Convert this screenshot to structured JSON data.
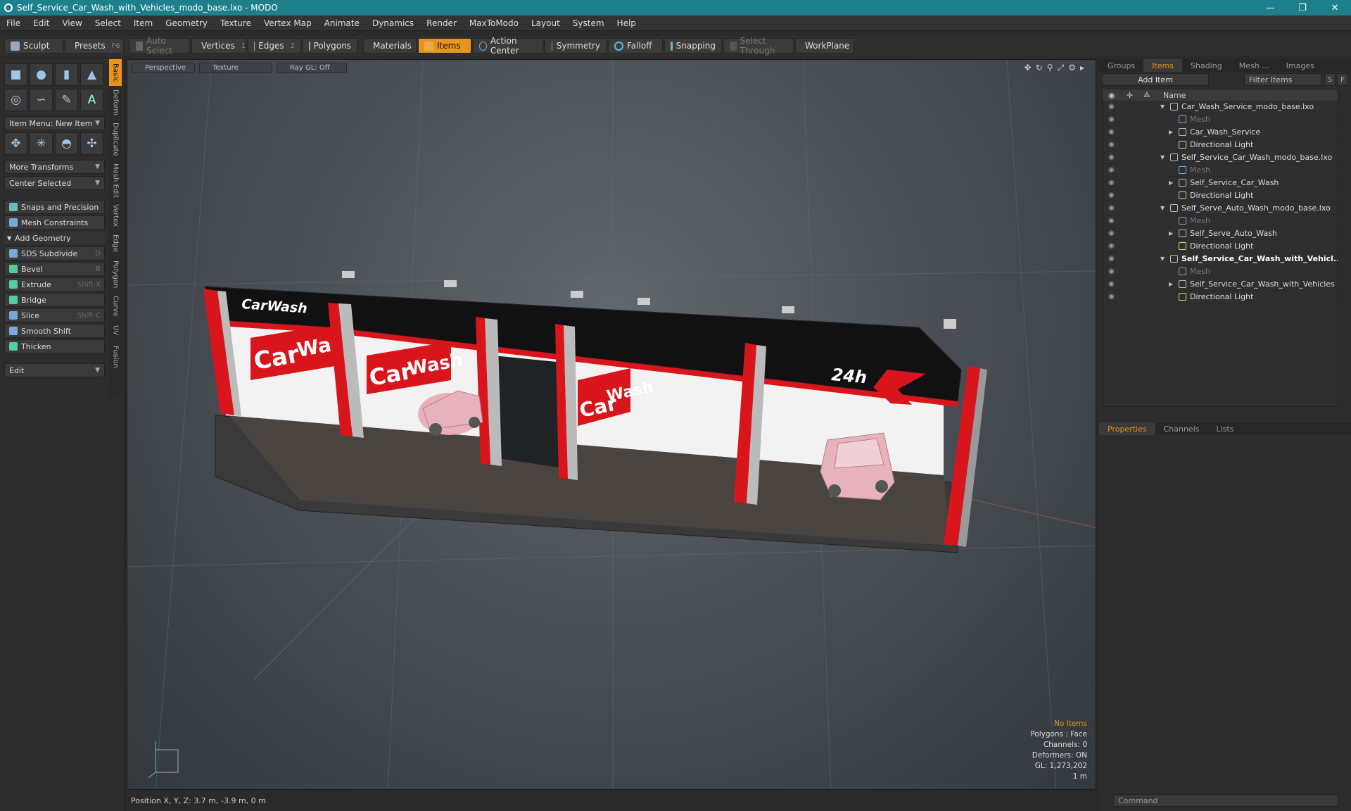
{
  "window": {
    "title": "Self_Service_Car_Wash_with_Vehicles_modo_base.lxo - MODO",
    "minimize": "—",
    "restore": "❐",
    "close": "✕"
  },
  "menu": [
    "File",
    "Edit",
    "View",
    "Select",
    "Item",
    "Geometry",
    "Texture",
    "Vertex Map",
    "Animate",
    "Dynamics",
    "Render",
    "MaxToModo",
    "Layout",
    "System",
    "Help"
  ],
  "toolbar": {
    "sculpt": "Sculpt",
    "presets": "Presets",
    "presets_key": "F6",
    "auto_select": "Auto Select",
    "vertices": "Vertices",
    "vertices_key": "1",
    "edges": "Edges",
    "edges_key": "2",
    "polygons": "Polygons",
    "materials": "Materials",
    "items": "Items",
    "action_center": "Action Center",
    "symmetry": "Symmetry",
    "falloff": "Falloff",
    "snapping": "Snapping",
    "select_through": "Select Through",
    "workplane": "WorkPlane"
  },
  "left": {
    "item_menu": "Item Menu: New Item",
    "more_transforms": "More Transforms",
    "center_selected": "Center Selected",
    "snaps": "Snaps and Precision",
    "mesh_constraints": "Mesh Constraints",
    "add_geometry": "Add Geometry",
    "tools": [
      {
        "label": "SDS Subdivide",
        "key": "D"
      },
      {
        "label": "Bevel",
        "key": "B"
      },
      {
        "label": "Extrude",
        "key": "Shift-X"
      },
      {
        "label": "Bridge",
        "key": ""
      },
      {
        "label": "Slice",
        "key": "Shift-C"
      },
      {
        "label": "Smooth Shift",
        "key": ""
      },
      {
        "label": "Thicken",
        "key": ""
      }
    ],
    "edit": "Edit",
    "vtabs": [
      "Basic",
      "Deform",
      "Duplicate",
      "Mesh Edit",
      "Vertex",
      "Edge",
      "Polygon",
      "Curve",
      "UV",
      "Fusion"
    ]
  },
  "viewport": {
    "perspective": "Perspective",
    "texture": "Texture",
    "raygl": "Ray GL: Off",
    "stats": {
      "no_items": "No Items",
      "polygons": "Polygons : Face",
      "channels": "Channels: 0",
      "deformers": "Deformers: ON",
      "gl": "GL: 1,273,202",
      "scale": "1 m"
    },
    "signs": {
      "carwash": "CarWash",
      "car": "Car",
      "wash": "Wash",
      "24h": "24h"
    }
  },
  "status": {
    "position": "Position X, Y, Z:  3.7 m, -3.9 m, 0 m"
  },
  "right": {
    "tabs": [
      "Groups",
      "Items",
      "Shading",
      "Mesh ...",
      "Images"
    ],
    "add_item": "Add Item",
    "filter": "Filter Items",
    "s": "S",
    "f": "F",
    "name_col": "Name",
    "tree": [
      {
        "label": "Car_Wash_Service_modo_base.lxo",
        "level": 0,
        "type": "scene"
      },
      {
        "label": "Mesh",
        "level": 1,
        "type": "mesh",
        "dim": true
      },
      {
        "label": "Car_Wash_Service",
        "level": 1,
        "type": "group",
        "arrow": true
      },
      {
        "label": "Directional Light",
        "level": 1,
        "type": "light"
      },
      {
        "label": "Self_Service_Car_Wash_modo_base.lxo",
        "level": 0,
        "type": "scene"
      },
      {
        "label": "Mesh",
        "level": 1,
        "type": "mesh",
        "dim": true
      },
      {
        "label": "Self_Service_Car_Wash",
        "level": 1,
        "type": "group",
        "arrow": true
      },
      {
        "label": "Directional Light",
        "level": 1,
        "type": "light"
      },
      {
        "label": "Self_Serve_Auto_Wash_modo_base.lxo",
        "level": 0,
        "type": "scene"
      },
      {
        "label": "Mesh",
        "level": 1,
        "type": "mesh",
        "dim": true
      },
      {
        "label": "Self_Serve_Auto_Wash",
        "level": 1,
        "type": "group",
        "arrow": true
      },
      {
        "label": "Directional Light",
        "level": 1,
        "type": "light"
      },
      {
        "label": "Self_Service_Car_Wash_with_Vehicl...",
        "level": 0,
        "type": "scene",
        "bold": true
      },
      {
        "label": "Mesh",
        "level": 1,
        "type": "mesh",
        "dim": true
      },
      {
        "label": "Self_Service_Car_Wash_with_Vehicles",
        "level": 1,
        "type": "group",
        "arrow": true
      },
      {
        "label": "Directional Light",
        "level": 1,
        "type": "light"
      }
    ],
    "prop_tabs": [
      "Properties",
      "Channels",
      "Lists"
    ],
    "command": "Command"
  }
}
